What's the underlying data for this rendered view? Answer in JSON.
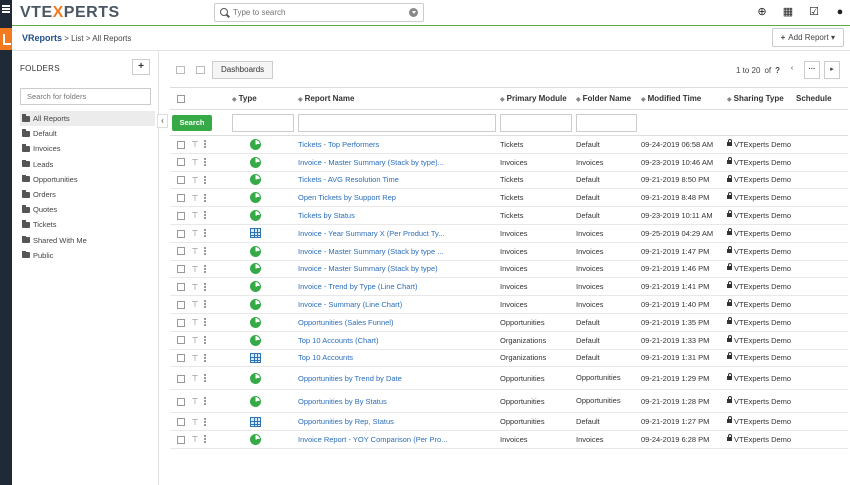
{
  "app": {
    "logo_prefix": "VTE",
    "logo_x": "X",
    "logo_suffix": "PERTS",
    "search_placeholder": "Type to search"
  },
  "top_icons": [
    {
      "name": "add-circle-icon",
      "glyph": "⊕"
    },
    {
      "name": "calendar-icon",
      "glyph": "▦"
    },
    {
      "name": "tasks-check-icon",
      "glyph": "☑"
    },
    {
      "name": "user-icon",
      "glyph": "●"
    }
  ],
  "breadcrumb": {
    "module": "VReports",
    "sep1": " > ",
    "list": "List",
    "sep2": " > ",
    "current": "All Reports"
  },
  "add_report_label": "Add Report",
  "sidebar": {
    "title": "FOLDERS",
    "add_label": "+",
    "search_placeholder": "Search for folders",
    "folders": [
      "All Reports",
      "Default",
      "Invoices",
      "Leads",
      "Opportunities",
      "Orders",
      "Quotes",
      "Tickets",
      "Shared With Me",
      "Public"
    ]
  },
  "toolbar": {
    "dashboards_label": "Dashboards",
    "pager_text": "1 to 20",
    "pager_of": "of",
    "pager_total": "?",
    "more_label": "···",
    "next_label": "▸",
    "prev_label": "‹"
  },
  "table": {
    "headers": {
      "type": "Type",
      "name": "Report Name",
      "module": "Primary Module",
      "folder": "Folder Name",
      "modified": "Modified Time",
      "sharing": "Sharing Type",
      "schedule": "Schedule"
    },
    "search_label": "Search",
    "rows": [
      {
        "type": "chart",
        "name": "Tickets - Top Performers",
        "module": "Tickets",
        "folder": "Default",
        "modified": "09-24-2019 06:58 AM",
        "sharing": "VTExperts Demo"
      },
      {
        "type": "chart",
        "name": "Invoice - Master Summary (Stack by type)...",
        "module": "Invoices",
        "folder": "Invoices",
        "modified": "09-23-2019 10:46 AM",
        "sharing": "VTExperts Demo"
      },
      {
        "type": "chart",
        "name": "Tickets - AVG Resolution Time",
        "module": "Tickets",
        "folder": "Default",
        "modified": "09-21-2019 8:50 PM",
        "sharing": "VTExperts Demo"
      },
      {
        "type": "chart",
        "name": "Open Tickets by Support Rep",
        "module": "Tickets",
        "folder": "Default",
        "modified": "09-21-2019 8:48 PM",
        "sharing": "VTExperts Demo"
      },
      {
        "type": "chart",
        "name": "Tickets by Status",
        "module": "Tickets",
        "folder": "Default",
        "modified": "09-23-2019 10:11 AM",
        "sharing": "VTExperts Demo"
      },
      {
        "type": "table",
        "name": "Invoice - Year Summary X (Per Product Ty...",
        "module": "Invoices",
        "folder": "Invoices",
        "modified": "09-25-2019 04:29 AM",
        "sharing": "VTExperts Demo"
      },
      {
        "type": "chart",
        "name": "Invoice - Master Summary (Stack by type ...",
        "module": "Invoices",
        "folder": "Invoices",
        "modified": "09-21-2019 1:47 PM",
        "sharing": "VTExperts Demo"
      },
      {
        "type": "chart",
        "name": "Invoice - Master Summary (Stack by type)",
        "module": "Invoices",
        "folder": "Invoices",
        "modified": "09-21-2019 1:46 PM",
        "sharing": "VTExperts Demo"
      },
      {
        "type": "chart",
        "name": "Invoice - Trend by Type (Line Chart)",
        "module": "Invoices",
        "folder": "Invoices",
        "modified": "09-21-2019 1:41 PM",
        "sharing": "VTExperts Demo"
      },
      {
        "type": "chart",
        "name": "Invoice - Summary (Line Chart)",
        "module": "Invoices",
        "folder": "Invoices",
        "modified": "09-21-2019 1:40 PM",
        "sharing": "VTExperts Demo"
      },
      {
        "type": "chart",
        "name": "Opportunities (Sales Funnel)",
        "module": "Opportunities",
        "folder": "Default",
        "modified": "09-21-2019 1:35 PM",
        "sharing": "VTExperts Demo"
      },
      {
        "type": "chart",
        "name": "Top 10 Accounts (Chart)",
        "module": "Organizations",
        "folder": "Default",
        "modified": "09-21-2019 1:33 PM",
        "sharing": "VTExperts Demo"
      },
      {
        "type": "table",
        "name": "Top 10 Accounts",
        "module": "Organizations",
        "folder": "Default",
        "modified": "09-21-2019 1:31 PM",
        "sharing": "VTExperts Demo"
      },
      {
        "type": "chart",
        "name": "Opportunities by Trend by Date",
        "module": "Opportunities",
        "folder": "Opportunities",
        "modified": "09-21-2019 1:29 PM",
        "sharing": "VTExperts Demo",
        "tall": true
      },
      {
        "type": "chart",
        "name": "Opportunities by By Status",
        "module": "Opportunities",
        "folder": "Opportunities",
        "modified": "09-21-2019 1:28 PM",
        "sharing": "VTExperts Demo",
        "tall": true
      },
      {
        "type": "table",
        "name": "Opportunities by Rep, Status",
        "module": "Opportunities",
        "folder": "Default",
        "modified": "09-21-2019 1:27 PM",
        "sharing": "VTExperts Demo"
      },
      {
        "type": "chart",
        "name": "Invoice Report - YOY Comparison (Per Pro...",
        "module": "Invoices",
        "folder": "Invoices",
        "modified": "09-24-2019 6:28 PM",
        "sharing": "VTExperts Demo"
      }
    ]
  },
  "colors": {
    "accent_green": "#35aa47",
    "link_blue": "#2a6ebb",
    "logo_orange": "#f47a20",
    "sidebar_dark": "#1f2a36"
  }
}
